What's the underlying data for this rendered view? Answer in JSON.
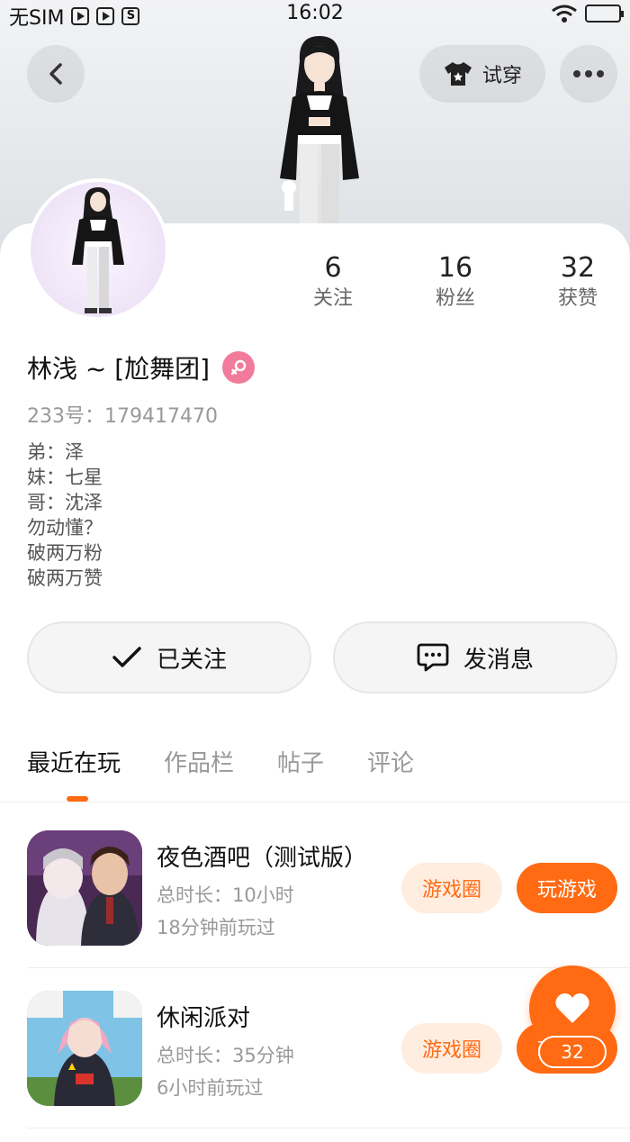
{
  "status_bar": {
    "carrier": "无SIM",
    "time": "16:02",
    "icons": [
      "video-icon",
      "play-icon",
      "s-app-icon"
    ]
  },
  "header": {
    "back_icon": "back-arrow-icon",
    "tryon_label": "试穿",
    "tryon_icon": "tshirt-icon",
    "more_icon": "more-dots-icon"
  },
  "profile": {
    "name": "林浅 ~ [尬舞团]",
    "gender": "female",
    "id_label": "233号：",
    "id_value": "179417470",
    "bio": [
      "弟：泽",
      "妹：七星",
      "哥：沈泽",
      "勿动懂？",
      "破两万粉",
      "破两万赞"
    ],
    "stats": [
      {
        "value": "6",
        "label": "关注"
      },
      {
        "value": "16",
        "label": "粉丝"
      },
      {
        "value": "32",
        "label": "获赞"
      }
    ]
  },
  "actions": {
    "follow_label": "已关注",
    "message_label": "发消息"
  },
  "tabs": [
    {
      "label": "最近在玩",
      "active": true
    },
    {
      "label": "作品栏",
      "active": false
    },
    {
      "label": "帖子",
      "active": false
    },
    {
      "label": "评论",
      "active": false
    }
  ],
  "games": [
    {
      "title": "夜色酒吧（测试版）",
      "duration": "总时长：10小时",
      "last_played": "18分钟前玩过",
      "circle_label": "游戏圈",
      "play_label": "玩游戏"
    },
    {
      "title": "休闲派对",
      "duration": "总时长：35分钟",
      "last_played": "6小时前玩过",
      "circle_label": "游戏圈",
      "play_label": "玩游戏"
    }
  ],
  "like_fab": {
    "icon": "heart-icon",
    "count": "32"
  },
  "colors": {
    "accent": "#ff6a13",
    "accent_light": "#ffede0",
    "gender_badge": "#f27a9b"
  }
}
